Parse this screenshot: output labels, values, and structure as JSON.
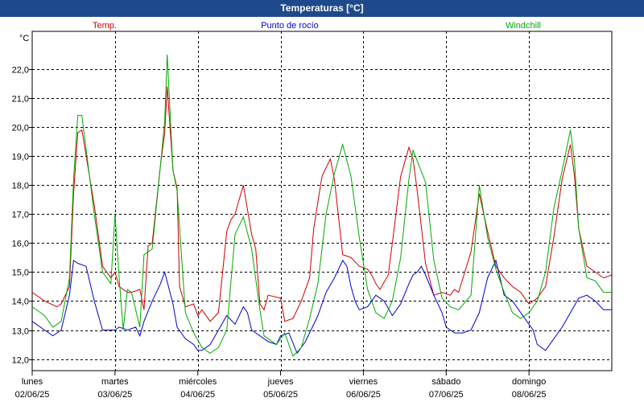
{
  "window": {
    "title": "Temperaturas [°C]"
  },
  "chart_data": {
    "type": "line",
    "ylabel": "°C",
    "ylim": [
      11.6,
      23.3
    ],
    "yticks": [
      "12,0",
      "13,0",
      "14,0",
      "15,0",
      "16,0",
      "17,0",
      "18,0",
      "19,0",
      "20,0",
      "21,0",
      "22,0"
    ],
    "ytick_values": [
      12,
      13,
      14,
      15,
      16,
      17,
      18,
      19,
      20,
      21,
      22
    ],
    "x_range_days": [
      0,
      7
    ],
    "day_labels": [
      {
        "day": "lunes",
        "date": "02/06/25"
      },
      {
        "day": "martes",
        "date": "03/06/25"
      },
      {
        "day": "miércoles",
        "date": "04/06/25"
      },
      {
        "day": "jueves",
        "date": "05/06/25"
      },
      {
        "day": "viernes",
        "date": "06/06/25"
      },
      {
        "day": "sábado",
        "date": "07/06/25"
      },
      {
        "day": "domingo",
        "date": "08/06/25"
      }
    ],
    "grid": true,
    "legend": "top",
    "series": [
      {
        "name": "Temp.",
        "color": "#cc0000",
        "x": [
          0.0,
          0.15,
          0.3,
          0.35,
          0.45,
          0.5,
          0.55,
          0.6,
          0.75,
          0.85,
          0.95,
          1.0,
          1.05,
          1.15,
          1.2,
          1.3,
          1.35,
          1.4,
          1.45,
          1.55,
          1.6,
          1.63,
          1.7,
          1.75,
          1.78,
          1.85,
          1.95,
          2.0,
          2.05,
          2.15,
          2.25,
          2.35,
          2.4,
          2.45,
          2.55,
          2.65,
          2.7,
          2.75,
          2.8,
          2.85,
          3.0,
          3.05,
          3.15,
          3.25,
          3.35,
          3.4,
          3.5,
          3.6,
          3.65,
          3.75,
          3.85,
          3.95,
          4.05,
          4.1,
          4.15,
          4.2,
          4.3,
          4.35,
          4.45,
          4.55,
          4.6,
          4.65,
          4.75,
          4.85,
          4.95,
          5.05,
          5.1,
          5.15,
          5.3,
          5.4,
          5.5,
          5.6,
          5.7,
          5.8,
          5.9,
          6.0,
          6.1,
          6.2,
          6.3,
          6.4,
          6.5,
          6.55,
          6.6,
          6.7,
          6.8,
          6.9,
          7.0
        ],
        "y": [
          14.3,
          14.0,
          13.8,
          13.9,
          14.5,
          17.7,
          19.8,
          19.9,
          17.3,
          15.2,
          14.8,
          15.0,
          14.5,
          14.3,
          14.3,
          14.4,
          13.7,
          15.9,
          16.0,
          18.7,
          19.8,
          21.4,
          18.5,
          17.9,
          14.5,
          13.8,
          13.9,
          13.5,
          13.7,
          13.3,
          13.6,
          16.4,
          16.8,
          17.0,
          18.0,
          16.3,
          15.8,
          13.9,
          13.7,
          14.2,
          14.1,
          13.3,
          13.4,
          14.0,
          14.8,
          16.5,
          18.3,
          18.9,
          18.2,
          15.6,
          15.5,
          15.2,
          15.1,
          14.9,
          14.6,
          14.4,
          14.9,
          16.0,
          18.3,
          19.3,
          18.9,
          17.8,
          15.3,
          14.2,
          14.3,
          14.2,
          14.4,
          14.3,
          15.7,
          17.7,
          16.4,
          15.2,
          14.8,
          14.5,
          14.3,
          13.9,
          14.1,
          14.5,
          16.2,
          18.2,
          19.4,
          18.3,
          16.5,
          15.2,
          15.0,
          14.8,
          14.9
        ]
      },
      {
        "name": "Punto de rocío",
        "color": "#0000cc",
        "x": [
          0.0,
          0.15,
          0.25,
          0.35,
          0.45,
          0.5,
          0.55,
          0.65,
          0.75,
          0.85,
          0.95,
          1.0,
          1.05,
          1.15,
          1.25,
          1.3,
          1.35,
          1.45,
          1.55,
          1.6,
          1.7,
          1.75,
          1.85,
          1.95,
          2.0,
          2.05,
          2.15,
          2.25,
          2.35,
          2.45,
          2.55,
          2.6,
          2.65,
          2.75,
          2.85,
          2.95,
          3.0,
          3.1,
          3.2,
          3.3,
          3.45,
          3.55,
          3.65,
          3.75,
          3.8,
          3.85,
          3.9,
          3.95,
          4.05,
          4.15,
          4.25,
          4.35,
          4.45,
          4.55,
          4.6,
          4.65,
          4.7,
          4.75,
          4.85,
          4.95,
          5.0,
          5.1,
          5.2,
          5.3,
          5.4,
          5.5,
          5.6,
          5.7,
          5.8,
          5.9,
          6.0,
          6.05,
          6.1,
          6.2,
          6.3,
          6.4,
          6.5,
          6.6,
          6.7,
          6.8,
          6.9,
          7.0
        ],
        "y": [
          13.3,
          13.0,
          12.8,
          13.0,
          14.2,
          15.4,
          15.3,
          15.2,
          14.0,
          13.0,
          13.0,
          13.0,
          13.1,
          13.0,
          13.1,
          12.8,
          13.3,
          14.0,
          14.6,
          15.0,
          13.9,
          13.1,
          12.7,
          12.5,
          12.3,
          12.3,
          12.5,
          13.0,
          13.5,
          13.2,
          13.8,
          13.6,
          13.0,
          12.8,
          12.6,
          12.5,
          12.8,
          12.9,
          12.2,
          12.6,
          13.5,
          14.3,
          14.8,
          15.4,
          15.2,
          14.5,
          14.0,
          13.7,
          13.8,
          14.2,
          14.0,
          13.5,
          13.9,
          14.6,
          14.9,
          15.0,
          15.2,
          14.9,
          14.2,
          13.6,
          13.1,
          12.9,
          12.9,
          13.0,
          13.6,
          14.8,
          15.4,
          14.2,
          14.0,
          13.6,
          13.2,
          13.0,
          12.5,
          12.3,
          12.7,
          13.1,
          13.6,
          14.1,
          14.2,
          14.0,
          13.7,
          13.7
        ]
      },
      {
        "name": "Windchill",
        "color": "#00aa00",
        "x": [
          0.0,
          0.15,
          0.25,
          0.35,
          0.45,
          0.5,
          0.55,
          0.6,
          0.75,
          0.85,
          0.95,
          1.0,
          1.05,
          1.1,
          1.15,
          1.2,
          1.3,
          1.35,
          1.45,
          1.55,
          1.6,
          1.63,
          1.7,
          1.75,
          1.85,
          1.95,
          2.05,
          2.15,
          2.25,
          2.35,
          2.45,
          2.55,
          2.65,
          2.75,
          2.8,
          2.95,
          3.05,
          3.15,
          3.25,
          3.35,
          3.45,
          3.55,
          3.65,
          3.75,
          3.85,
          3.95,
          4.05,
          4.15,
          4.25,
          4.35,
          4.45,
          4.55,
          4.6,
          4.75,
          4.85,
          4.95,
          5.05,
          5.15,
          5.3,
          5.4,
          5.5,
          5.6,
          5.7,
          5.8,
          5.9,
          6.0,
          6.1,
          6.2,
          6.3,
          6.4,
          6.5,
          6.55,
          6.6,
          6.7,
          6.8,
          6.9,
          7.0
        ],
        "y": [
          13.8,
          13.5,
          13.1,
          13.3,
          14.8,
          18.2,
          20.4,
          20.4,
          17.0,
          15.0,
          14.6,
          17.0,
          14.8,
          13.0,
          14.4,
          14.3,
          13.1,
          15.6,
          15.8,
          18.7,
          20.2,
          22.5,
          18.5,
          17.8,
          13.6,
          12.9,
          12.4,
          12.2,
          12.4,
          13.0,
          16.3,
          16.9,
          15.8,
          13.7,
          12.8,
          12.5,
          12.9,
          12.1,
          12.4,
          13.4,
          14.6,
          17.0,
          18.4,
          19.4,
          18.3,
          16.2,
          14.4,
          13.6,
          13.4,
          14.0,
          15.5,
          18.2,
          19.2,
          18.1,
          15.4,
          14.1,
          13.8,
          13.7,
          14.2,
          18.0,
          16.2,
          15.1,
          14.3,
          13.6,
          13.4,
          13.6,
          14.0,
          15.0,
          17.2,
          18.5,
          19.9,
          18.8,
          16.5,
          14.8,
          14.7,
          14.3,
          14.3
        ]
      }
    ]
  }
}
